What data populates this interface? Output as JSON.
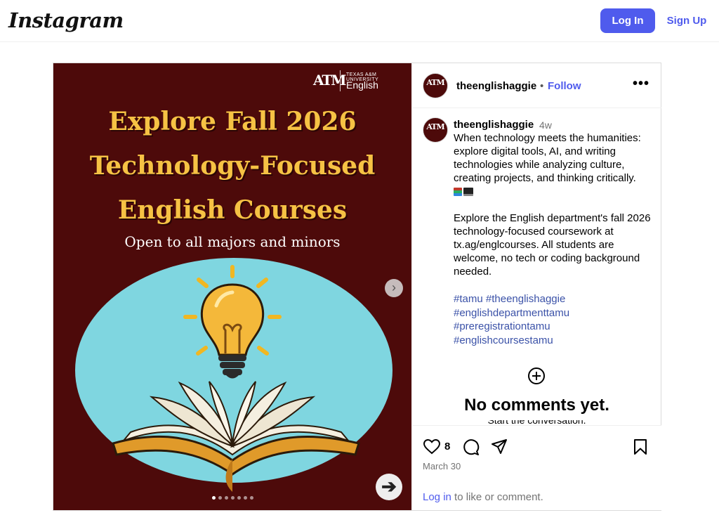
{
  "nav": {
    "logo_text": "Instagram",
    "login_label": "Log In",
    "signup_label": "Sign Up",
    "accent_color": "#4f5bed"
  },
  "post": {
    "image": {
      "brand_mark": "ATM",
      "brand_university": "TEXAS A&M UNIVERSITY",
      "brand_department": "English",
      "headline_line1": "Explore Fall 2026",
      "headline_line2": "Technology-Focused",
      "headline_line3": "English Courses",
      "subline": "Open to all majors and minors",
      "background_color": "#4d0a0a",
      "headline_color": "#f6c244",
      "oval_color": "#7fd6e0",
      "next_small_icon": "chevron-right-icon",
      "next_big_icon": "arrow-right-icon",
      "carousel_count": 7,
      "carousel_active": 1
    },
    "header": {
      "username": "theenglishaggie",
      "separator": "•",
      "follow_label": "Follow",
      "more_icon": "more-horizontal-icon",
      "more_glyph": "•••"
    },
    "caption": {
      "username": "theenglishaggie",
      "time": "4w",
      "paragraph1": "When technology meets the humanities: explore digital tools, AI, and writing technologies while analyzing culture, creating projects, and thinking critically.",
      "emojis": [
        "books-emoji",
        "laptop-emoji"
      ],
      "paragraph2": "Explore the English department's fall 2026 technology-focused coursework at tx.ag/englcourses. All students are welcome, no tech or coding background needed.",
      "hashtags": [
        "#tamu",
        "#theenglishaggie",
        "#englishdepartmenttamu",
        "#preregistrationtamu",
        "#englishcoursestamu"
      ]
    },
    "comments": {
      "add_icon": "plus-circle-icon",
      "empty_title": "No comments yet.",
      "empty_subtitle": "Start the conversation."
    },
    "actions": {
      "like_icon": "heart-icon",
      "like_count": "8",
      "comment_icon": "comment-icon",
      "share_icon": "send-icon",
      "save_icon": "bookmark-icon",
      "date": "March 30",
      "login_link": "Log in",
      "login_suffix": "to like or comment."
    }
  }
}
